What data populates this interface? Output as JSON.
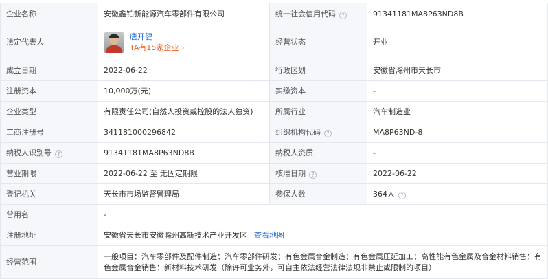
{
  "rows": {
    "company_name": {
      "label": "企业名称",
      "value": "安徽鑫铂新能源汽车零部件有限公司"
    },
    "credit_code": {
      "label": "统一社会信用代码",
      "value": "91341181MA8P63ND8B"
    },
    "legal_rep": {
      "label": "法定代表人",
      "name": "唐开健",
      "link": "TA有15家企业 ›"
    },
    "status": {
      "label": "经营状态",
      "value": "开业"
    },
    "founded": {
      "label": "成立日期",
      "value": "2022-06-22"
    },
    "region": {
      "label": "行政区划",
      "value": "安徽省滁州市天长市"
    },
    "reg_capital": {
      "label": "注册资本",
      "value": "10,000万(元)"
    },
    "paid_capital": {
      "label": "实缴资本",
      "value": "-"
    },
    "company_type": {
      "label": "企业类型",
      "value": "有限责任公司(自然人投资或控股的法人独资)"
    },
    "industry": {
      "label": "所属行业",
      "value": "汽车制造业"
    },
    "reg_number": {
      "label": "工商注册号",
      "value": "341181000296842"
    },
    "org_code": {
      "label": "组织机构代码",
      "value": "MA8P63ND-8"
    },
    "taxpayer_id": {
      "label": "纳税人识别号",
      "value": "91341181MA8P63ND8B"
    },
    "taxpayer_qual": {
      "label": "纳税人资质",
      "value": "-"
    },
    "business_term": {
      "label": "营业期限",
      "value": "2022-06-22 至 无固定期限"
    },
    "approval_date": {
      "label": "核准日期",
      "value": "2022-06-22"
    },
    "reg_authority": {
      "label": "登记机关",
      "value": "天长市市场监督管理局"
    },
    "insured": {
      "label": "参保人数",
      "value": "364人"
    },
    "former_name": {
      "label": "曾用名",
      "value": "-"
    },
    "address": {
      "label": "注册地址",
      "value": "安徽省天长市安徽滁州高新技术产业开发区",
      "map_link": "查看地图"
    },
    "scope": {
      "label": "经营范围",
      "value": "一般项目：汽车零部件及配件制造；汽车零部件研发；有色金属合金制造；有色金属压延加工；高性能有色金属及合金材料销售；有色金属合金销售；新材料技术研发（除许可业务外，可自主依法经营法律法规非禁止或限制的项目）"
    }
  },
  "help_icon": "question-circle-icon"
}
